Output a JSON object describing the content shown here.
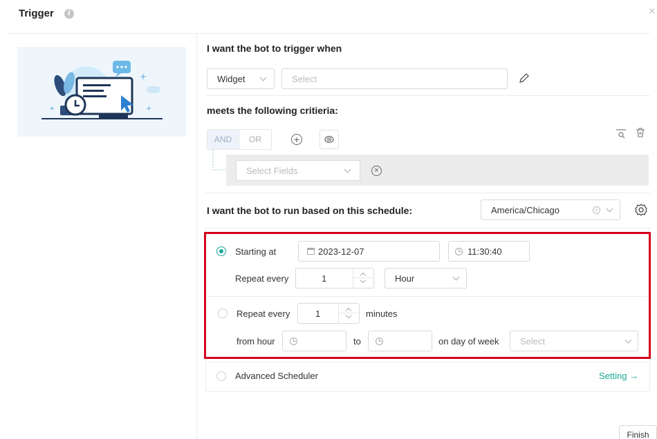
{
  "dialog": {
    "title": "Trigger",
    "info_icon": "i",
    "close_icon": "×"
  },
  "trigger": {
    "heading": "I want the bot to trigger when",
    "type_value": "Widget",
    "select_placeholder": "Select"
  },
  "criteria": {
    "heading": "meets the following critieria:",
    "and_label": "AND",
    "or_label": "OR",
    "field_placeholder": "Select Fields"
  },
  "schedule": {
    "heading": "I want the bot to run based on this schedule:",
    "timezone": "America/Chicago",
    "option1": {
      "starting_label": "Starting at",
      "date": "2023-12-07",
      "time": "11:30:40",
      "repeat_label": "Repeat every",
      "repeat_value": "1",
      "unit": "Hour"
    },
    "option2": {
      "repeat_label": "Repeat every",
      "repeat_value": "1",
      "minutes_label": "minutes",
      "from_hour_label": "from hour",
      "to_label": "to",
      "day_label": "on day of week",
      "day_placeholder": "Select"
    },
    "advanced": {
      "label": "Advanced Scheduler",
      "setting_link": "Setting →"
    }
  },
  "footer": {
    "finish_label": "Finish"
  }
}
